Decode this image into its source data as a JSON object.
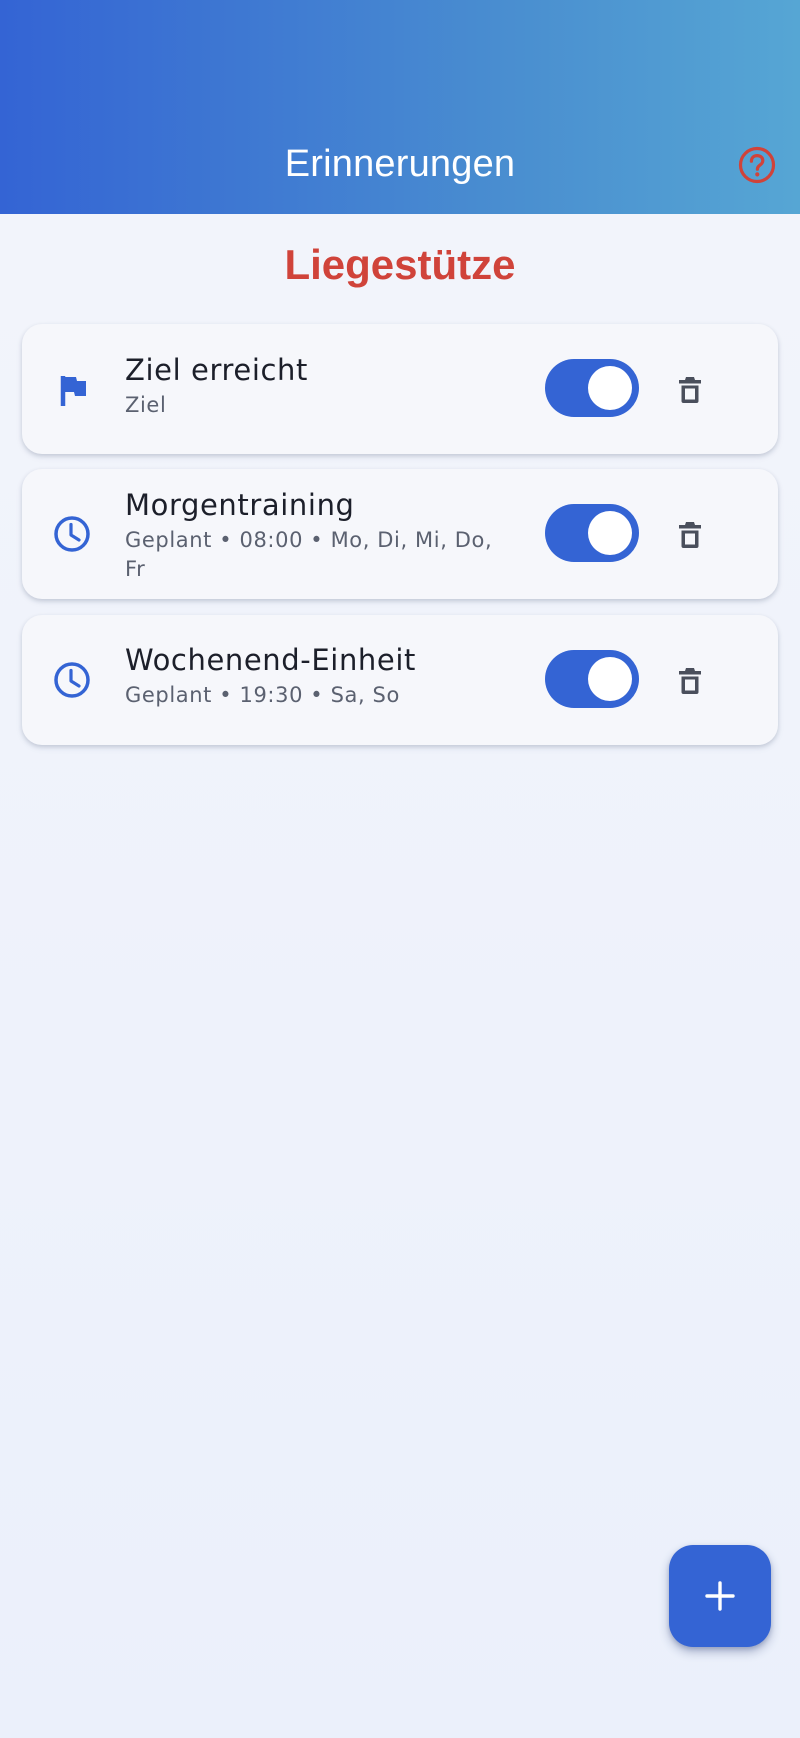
{
  "app_bar": {
    "title": "Erinnerungen",
    "help_icon": "help-circle-icon",
    "help_icon_color": "#d0433a"
  },
  "section": {
    "title": "Liegestütze"
  },
  "reminders": [
    {
      "icon": "flag-icon",
      "title": "Ziel erreicht",
      "subtitle": "Ziel",
      "enabled": true
    },
    {
      "icon": "clock-icon",
      "title": "Morgentraining",
      "subtitle": "Geplant • 08:00 • Mo, Di, Mi, Do, Fr",
      "enabled": true
    },
    {
      "icon": "clock-icon",
      "title": "Wochenend-Einheit",
      "subtitle": "Geplant • 19:30 • Sa, So",
      "enabled": true
    }
  ],
  "fab": {
    "icon": "plus-icon"
  },
  "colors": {
    "primary": "#3464d4",
    "accent": "#d0433a",
    "header_gradient_start": "#3464d4",
    "header_gradient_end": "#56a6d4",
    "text_primary": "#1c1f2a",
    "text_secondary": "#5b6170"
  }
}
